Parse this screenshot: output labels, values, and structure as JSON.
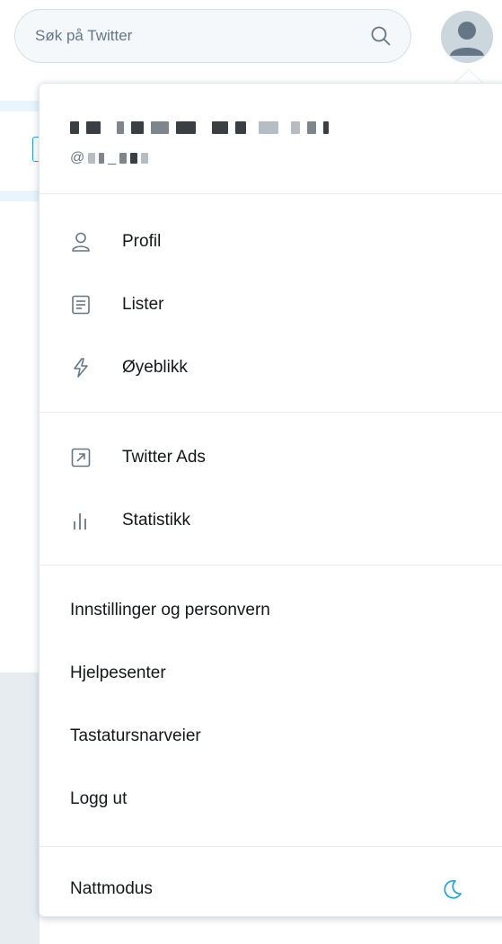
{
  "search": {
    "placeholder": "Søk på Twitter"
  },
  "user": {
    "handle_prefix": "@",
    "handle_tail": "_"
  },
  "menu": {
    "group1": [
      {
        "label": "Profil",
        "icon": "person-icon"
      },
      {
        "label": "Lister",
        "icon": "list-icon"
      },
      {
        "label": "Øyeblikk",
        "icon": "lightning-icon"
      }
    ],
    "group2": [
      {
        "label": "Twitter Ads",
        "icon": "external-arrow-icon"
      },
      {
        "label": "Statistikk",
        "icon": "bar-chart-icon"
      }
    ],
    "group3": [
      {
        "label": "Innstillinger og personvern"
      },
      {
        "label": "Hjelpesenter"
      },
      {
        "label": "Tastatursnarveier"
      },
      {
        "label": "Logg ut"
      }
    ],
    "night_mode": {
      "label": "Nattmodus",
      "icon": "moon-icon"
    }
  },
  "colors": {
    "accent": "#1da1f2",
    "text": "#14171a",
    "muted": "#657786",
    "border": "#e6ecf0"
  }
}
